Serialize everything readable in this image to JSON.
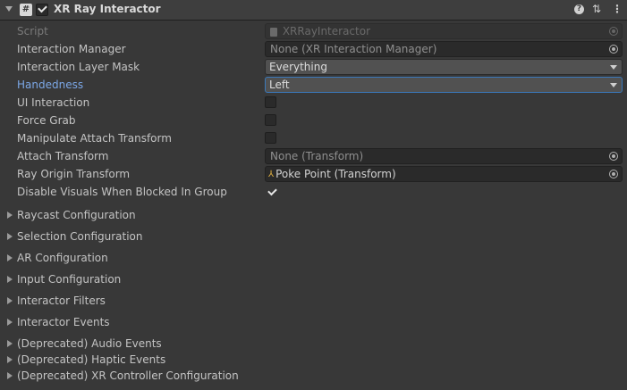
{
  "component": {
    "title": "XR Ray Interactor",
    "script_icon_glyph": "#",
    "header_icons": [
      "help-icon",
      "preset-icon",
      "menu-icon"
    ]
  },
  "properties": {
    "script": {
      "label": "Script",
      "value": "XRRayInteractor"
    },
    "interaction_manager": {
      "label": "Interaction Manager",
      "value": "None (XR Interaction Manager)"
    },
    "interaction_layer_mask": {
      "label": "Interaction Layer Mask",
      "value": "Everything"
    },
    "handedness": {
      "label": "Handedness",
      "value": "Left"
    },
    "ui_interaction": {
      "label": "UI Interaction",
      "checked": false
    },
    "force_grab": {
      "label": "Force Grab",
      "checked": false
    },
    "manipulate_attach_transform": {
      "label": "Manipulate Attach Transform",
      "checked": false
    },
    "attach_transform": {
      "label": "Attach Transform",
      "value": "None (Transform)"
    },
    "ray_origin_transform": {
      "label": "Ray Origin Transform",
      "value": "Poke Point (Transform)"
    },
    "disable_visuals": {
      "label": "Disable Visuals When Blocked In Group",
      "checked": true
    }
  },
  "sections": [
    "Raycast Configuration",
    "Selection Configuration",
    "AR Configuration",
    "Input Configuration",
    "Interactor Filters",
    "Interactor Events",
    "(Deprecated) Audio Events",
    "(Deprecated) Haptic Events",
    "(Deprecated) XR Controller Configuration"
  ],
  "colors": {
    "background": "#383838",
    "header": "#3e3e3e",
    "field": "#2a2a2a",
    "dropdown": "#515151",
    "focus_border": "#3a79bb",
    "highlight_label": "#7ca8e8"
  }
}
